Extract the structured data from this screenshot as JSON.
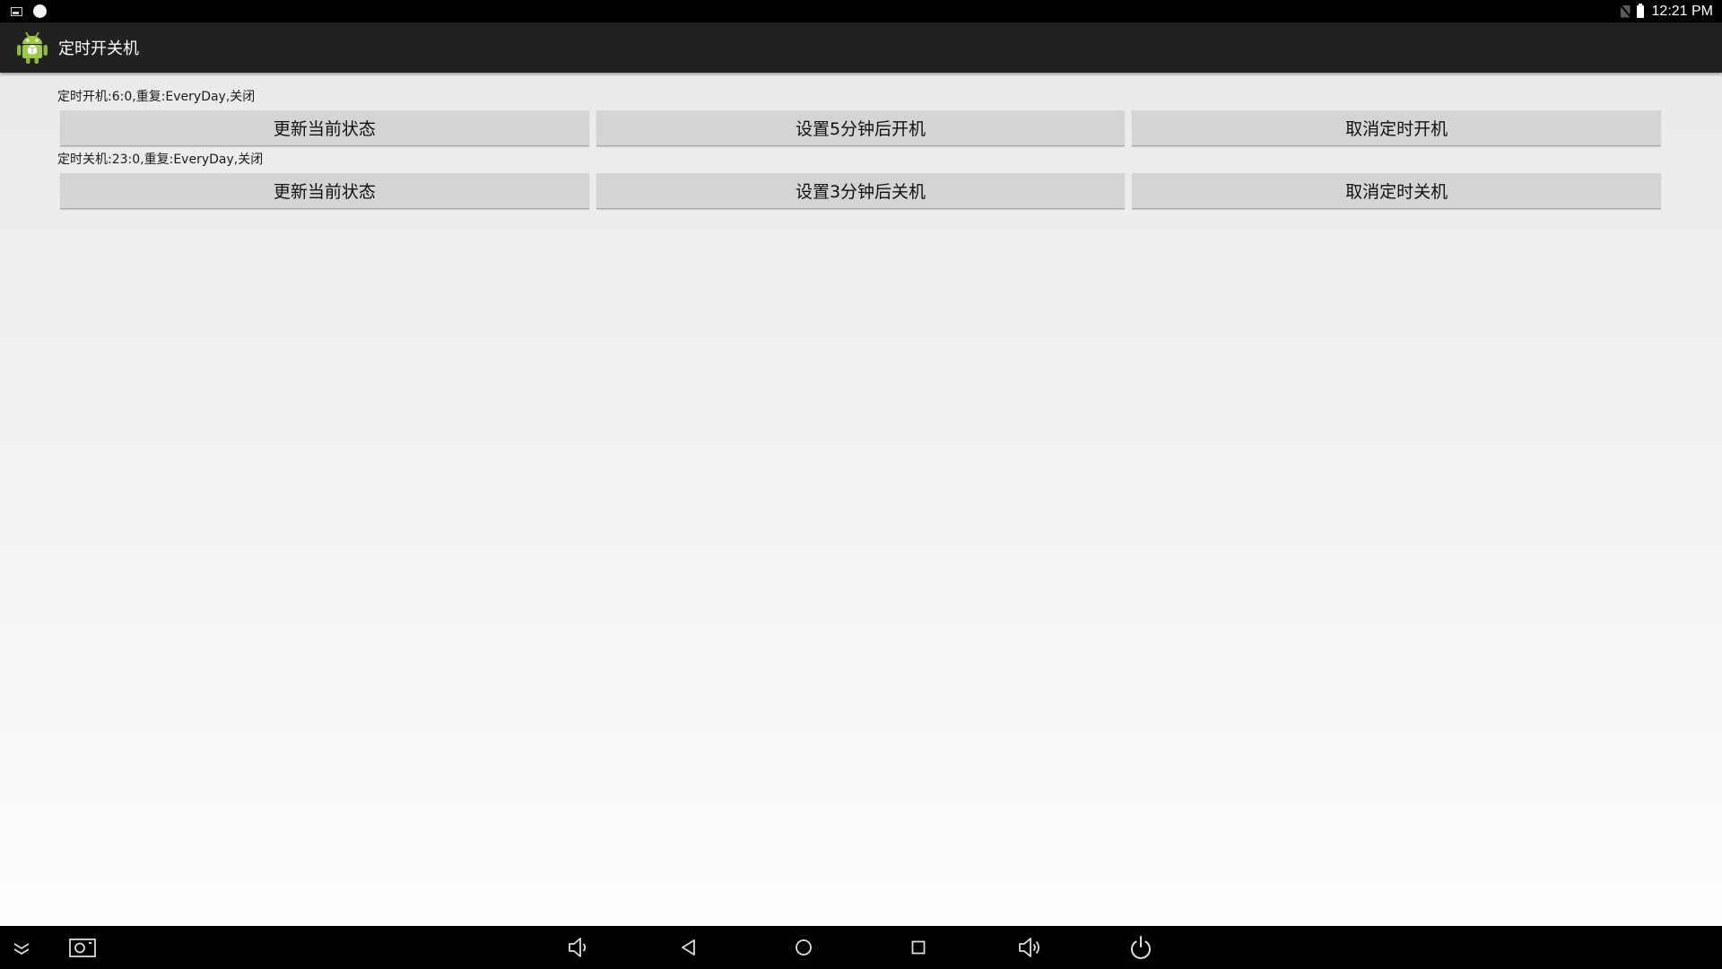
{
  "status_bar": {
    "time": "12:21 PM",
    "left_icons": [
      "image-notification-icon",
      "circle-notification-icon"
    ],
    "right_icons": [
      "no-sim-icon",
      "battery-icon"
    ]
  },
  "app_bar": {
    "title": "定时开关机",
    "icon": "android-app-icon"
  },
  "power_on": {
    "status": "定时开机:6:0,重复:EveryDay,关闭",
    "buttons": [
      "更新当前状态",
      "设置5分钟后开机",
      "取消定时开机"
    ]
  },
  "power_off": {
    "status": "定时关机:23:0,重复:EveryDay,关闭",
    "buttons": [
      "更新当前状态",
      "设置3分钟后关机",
      "取消定时关机"
    ]
  },
  "nav_bar": {
    "icons": [
      "hide-nav-icon",
      "screenshot-icon",
      "volume-down-icon",
      "back-icon",
      "home-icon",
      "recents-icon",
      "volume-up-icon",
      "power-icon"
    ]
  },
  "colors": {
    "status_bar": "#000000",
    "action_bar": "#212121",
    "button": "#d4d4d4",
    "nav_bar": "#000000"
  }
}
